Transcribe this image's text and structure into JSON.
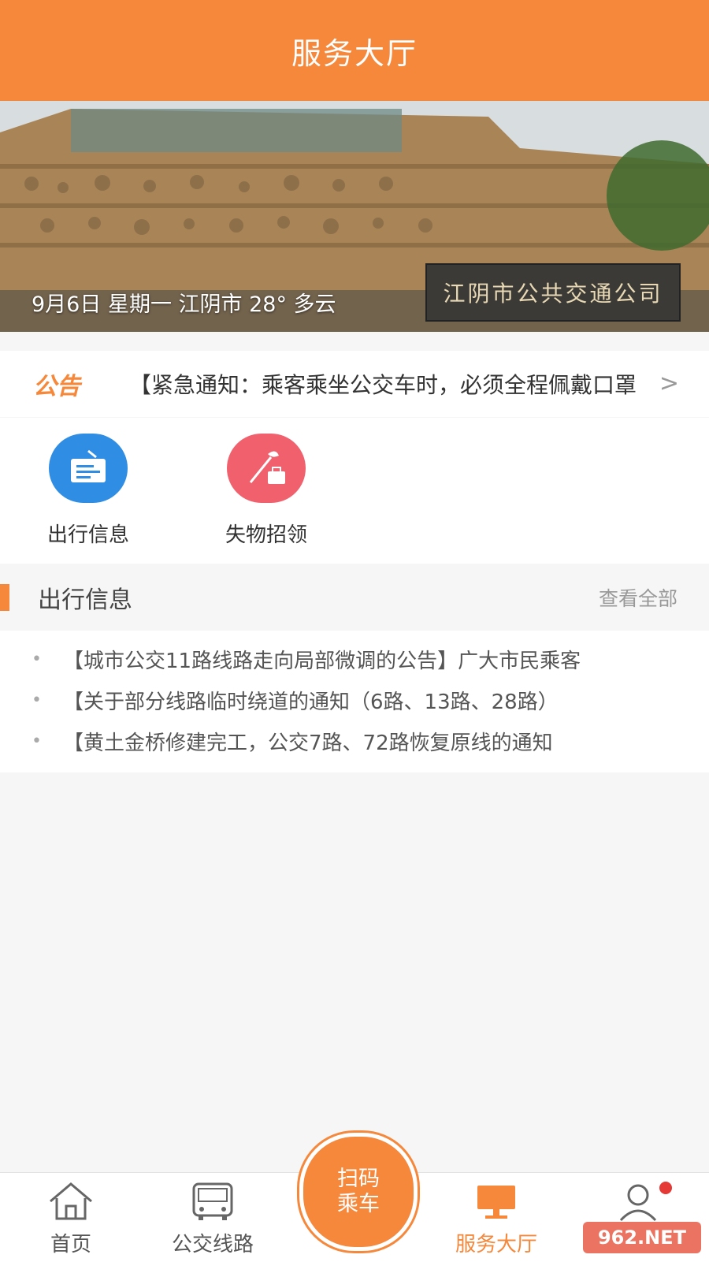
{
  "header": {
    "title": "服务大厅"
  },
  "banner": {
    "caption": "9月6日 星期一 江阴市 28° 多云",
    "sign_text": "江阴市公共交通公司"
  },
  "notice": {
    "tag": "公告",
    "text": "【紧急通知：乘客乘坐公交车时，必须全程佩戴口罩",
    "chevron": ">"
  },
  "shortcuts": [
    {
      "label": "出行信息",
      "icon": "notice-board-icon",
      "color": "#2f8de4"
    },
    {
      "label": "失物招领",
      "icon": "lost-found-icon",
      "color": "#f0606d"
    }
  ],
  "section": {
    "title": "出行信息",
    "more": "查看全部"
  },
  "news": [
    "【城市公交11路线路走向局部微调的公告】广大市民乘客",
    "【关于部分线路临时绕道的通知（6路、13路、28路）",
    "【黄土金桥修建完工，公交7路、72路恢复原线的通知"
  ],
  "tabbar": {
    "home": "首页",
    "bus_lines": "公交线路",
    "scan": [
      "扫码",
      "乘车"
    ],
    "service_hall": "服务大厅",
    "active_color": "#f5883b"
  },
  "watermark": "962.NET"
}
